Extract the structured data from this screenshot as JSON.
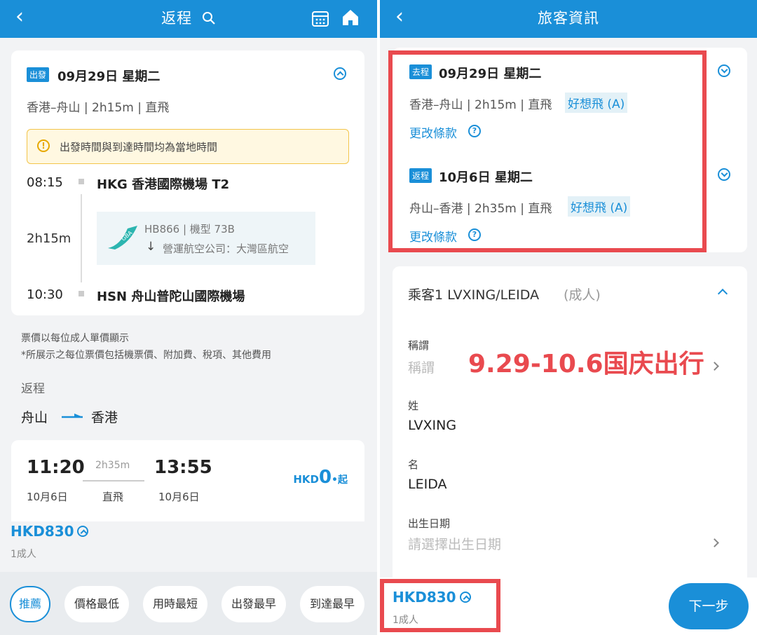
{
  "left": {
    "header": {
      "back_icon": "chevron-left-icon",
      "title": "返程",
      "icons": [
        "search-icon",
        "calendar-icon",
        "home-icon"
      ]
    },
    "outbound": {
      "badge": "出發",
      "date": "09月29日 星期二",
      "summary": "香港–舟山 | 2h15m | 直飛",
      "notice": "出發時間與到達時間均為當地時間",
      "dep_time": "08:15",
      "dep_airport": "HKG 香港國際機場 T2",
      "duration": "2h15m",
      "flight_info": "HB866 | 機型 73B",
      "operator": "營運航空公司：大灣區航空",
      "airline_logo_text": "GBA",
      "arr_time": "10:30",
      "arr_airport": "HSN 舟山普陀山國際機場"
    },
    "price_note_1": "票價以每位成人單價顯示",
    "price_note_2": "*所展示之每位票價包括機票價、附加費、稅項、其他費用",
    "section_label": "返程",
    "route_from": "舟山",
    "route_to": "香港",
    "result": {
      "dep_time": "11:20",
      "duration": "2h35m",
      "arr_time": "13:55",
      "dep_date": "10月6日",
      "stop": "直飛",
      "arr_date": "10月6日",
      "price_currency": "HKD",
      "price_value": "0",
      "price_suffix": "•起"
    },
    "total_price": "HKD830",
    "pax": "1成人",
    "sort_options": [
      "推薦",
      "價格最低",
      "用時最短",
      "出發最早",
      "到達最早"
    ]
  },
  "right": {
    "header": {
      "back_icon": "chevron-left-icon",
      "title": "旅客資訊"
    },
    "leg1": {
      "badge": "去程",
      "date": "09月29日 星期二",
      "summary": "香港–舟山 | 2h15m | 直飛",
      "fare": "好想飛 (A)",
      "rules": "更改條款"
    },
    "leg2": {
      "badge": "返程",
      "date": "10月6日 星期二",
      "summary": "舟山–香港 | 2h35m | 直飛",
      "fare": "好想飛 (A)",
      "rules": "更改條款"
    },
    "passenger_title": "乘客1 LVXING/LEIDA",
    "passenger_type": "(成人)",
    "annotation": "9.29-10.6国庆出行",
    "fields": {
      "title_label": "稱謂",
      "title_placeholder": "稱謂",
      "surname_label": "姓",
      "surname_value": "LVXING",
      "given_label": "名",
      "given_value": "LEIDA",
      "dob_label": "出生日期",
      "dob_placeholder": "請選擇出生日期"
    },
    "total_price": "HKD830",
    "pax": "1成人",
    "next_button": "下一步"
  },
  "colors": {
    "primary": "#1a8fd8",
    "annotation_red": "#e94a4f",
    "notice_bg": "#fff8e1",
    "notice_border": "#f3c54b"
  }
}
